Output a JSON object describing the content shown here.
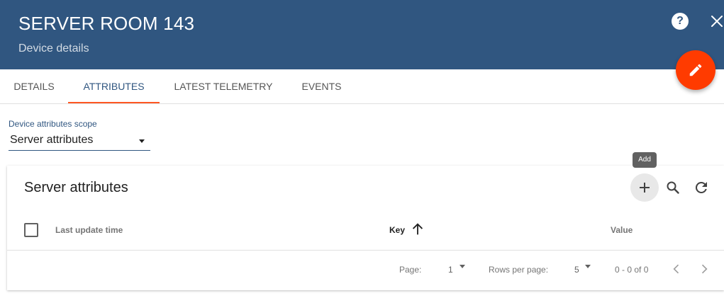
{
  "header": {
    "title": "SERVER ROOM 143",
    "subtitle": "Device details",
    "help_symbol": "?",
    "icons": [
      "help-icon",
      "close-icon",
      "edit-icon"
    ]
  },
  "tabs": [
    {
      "label": "DETAILS",
      "active": false
    },
    {
      "label": "ATTRIBUTES",
      "active": true
    },
    {
      "label": "LATEST TELEMETRY",
      "active": false
    },
    {
      "label": "EVENTS",
      "active": false
    }
  ],
  "scope": {
    "label": "Device attributes scope",
    "value": "Server attributes"
  },
  "card": {
    "title": "Server attributes",
    "tooltip": "Add",
    "toolbar_icons": [
      "add-icon",
      "search-icon",
      "refresh-icon"
    ]
  },
  "table": {
    "columns": [
      {
        "label": "Last update time",
        "sorted": false
      },
      {
        "label": "Key",
        "sorted": true,
        "sort_direction": "ascending"
      },
      {
        "label": "Value",
        "sorted": false
      }
    ],
    "rows": []
  },
  "paginator": {
    "page_label": "Page:",
    "page_value": "1",
    "rows_label": "Rows per page:",
    "rows_value": "5",
    "range": "0 - 0 of 0"
  },
  "colors": {
    "header": "#305680",
    "accent": "#ff5722",
    "fab": "#ff3b00"
  }
}
